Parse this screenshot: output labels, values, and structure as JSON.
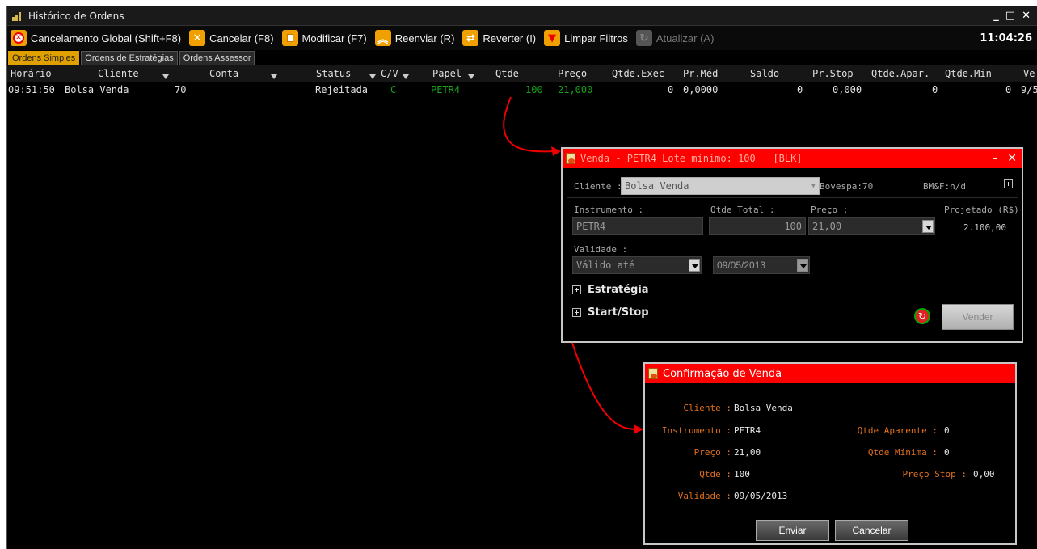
{
  "window": {
    "title": "Histórico de Ordens",
    "minimize": "_",
    "maximize": "□",
    "close": "✕"
  },
  "toolbar": {
    "buttons": [
      {
        "label": "Cancelamento Global (Shift+F8)",
        "icon": "cancel-global-icon",
        "color": "#f0a000"
      },
      {
        "label": "Cancelar (F8)",
        "icon": "cancel-icon",
        "color": "#f0a000"
      },
      {
        "label": "Modificar (F7)",
        "icon": "modify-icon",
        "color": "#f0a000"
      },
      {
        "label": "Reenviar (R)",
        "icon": "resend-icon",
        "color": "#f0a000"
      },
      {
        "label": "Reverter (I)",
        "icon": "revert-icon",
        "color": "#f0a000"
      },
      {
        "label": "Limpar Filtros",
        "icon": "clear-filter-icon",
        "color": "#f0a000"
      },
      {
        "label": "Atualizar (A)",
        "icon": "refresh-icon",
        "color": "#555555"
      }
    ],
    "clock": "11:04:26"
  },
  "tabs": [
    "Ordens Simples",
    "Ordens de Estratégias",
    "Ordens Assessor"
  ],
  "table": {
    "headers": [
      "Horário",
      "Cliente",
      "Conta",
      "Status",
      "C/V",
      "Papel",
      "Qtde",
      "Preço",
      "Qtde.Exec",
      "Pr.Méd",
      "Saldo",
      "Pr.Stop",
      "Qtde.Apar.",
      "Qtde.Min",
      "Ve"
    ],
    "rows": [
      {
        "horario": "09:51:50",
        "cliente": "Bolsa Venda",
        "conta": "70",
        "status": "Rejeitada",
        "cv": "C",
        "papel": "PETR4",
        "qtde": "100",
        "preco": "21,000",
        "qtde_exec": "0",
        "pr_med": "0,0000",
        "saldo": "0",
        "pr_stop": "0,000",
        "qtde_apar": "0",
        "qtde_min": "0",
        "ve": "9/5"
      }
    ]
  },
  "order_dialog": {
    "title": "Venda - PETR4 Lote mínimo: 100   [BLK]",
    "cliente_label": "Cliente :",
    "cliente_value": "Bolsa Venda",
    "bovespa": "Bovespa:70",
    "bmf": "BM&F:n/d",
    "instrumento_label": "Instrumento :",
    "instrumento_value": "PETR4",
    "qtde_total_label": "Qtde Total :",
    "qtde_total_value": "100",
    "preco_label": "Preço :",
    "preco_value": "21,00",
    "projetado_label": "Projetado (R$)",
    "projetado_value": "2.100,00",
    "validade_label": "Validade :",
    "validade_value": "Válido até",
    "validade_date": "09/05/2013",
    "estrategia_label": "Estratégia",
    "startstop_label": "Start/Stop",
    "vender_button": "Vender"
  },
  "confirm_dialog": {
    "title": "Confirmação de Venda",
    "cliente_label": "Cliente :",
    "cliente_value": "Bolsa Venda",
    "instrumento_label": "Instrumento :",
    "instrumento_value": "PETR4",
    "preco_label": "Preço :",
    "preco_value": "21,00",
    "qtde_label": "Qtde :",
    "qtde_value": "100",
    "validade_label": "Validade :",
    "validade_value": "09/05/2013",
    "qtde_aparente_label": "Qtde Aparente :",
    "qtde_aparente_value": "0",
    "qtde_minima_label": "Qtde Mínima :",
    "qtde_minima_value": "0",
    "preco_stop_label": "Preço Stop :",
    "preco_stop_value": "0,00",
    "enviar_button": "Enviar",
    "cancelar_button": "Cancelar"
  },
  "colors": {
    "accent_red": "#ff0000",
    "accent_orange": "#e07020",
    "green": "#19a019",
    "tab_active": "#e0a000"
  }
}
